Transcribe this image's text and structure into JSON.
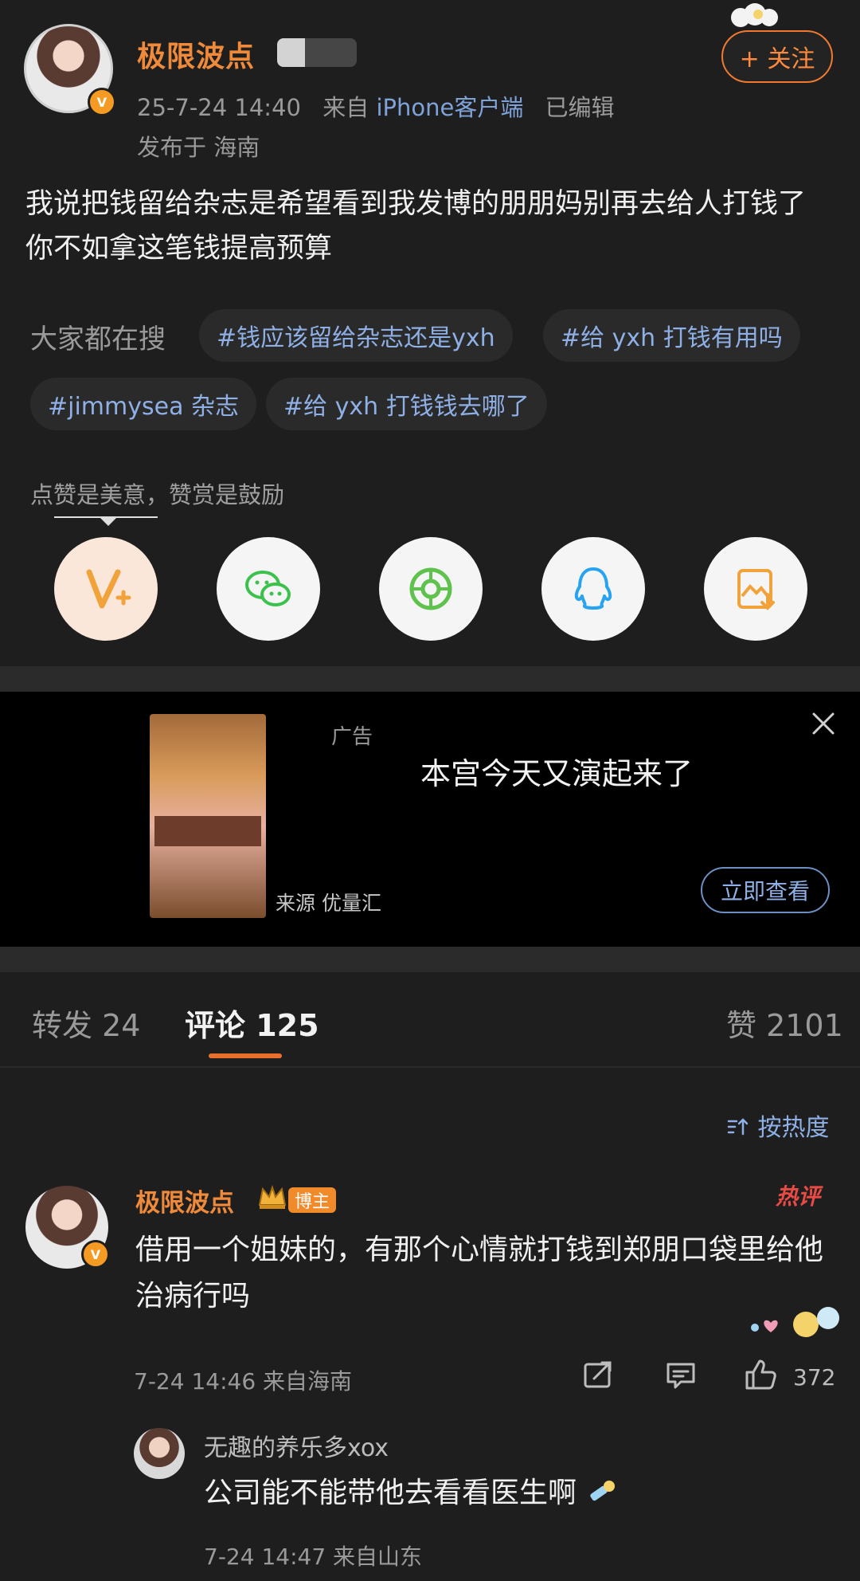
{
  "header": {
    "author": "极限波点",
    "time": "25-7-24 14:40",
    "source_prefix": "来自",
    "source_client": "iPhone客户端",
    "edited": "已编辑",
    "location": "发布于 海南",
    "follow_label": "+ 关注"
  },
  "post": {
    "text": "我说把钱留给杂志是希望看到我发博的朋朋妈别再去给人打钱了 你不如拿这笔钱提高预算"
  },
  "search": {
    "label": "大家都在搜",
    "tags": [
      "#钱应该留给杂志还是yxh",
      "#给 yxh 打钱有用吗",
      "#jimmysea 杂志",
      "#给 yxh 打钱钱去哪了"
    ]
  },
  "share": {
    "tip": "点赞是美意，赞赏是鼓励",
    "icons": [
      "reward-icon",
      "wechat-icon",
      "moments-icon",
      "qq-icon",
      "save-image-icon"
    ],
    "colors": {
      "reward": "#f2a23a",
      "wechat": "#3cc24c",
      "moments": "#5fc24c",
      "qq": "#27a3f0",
      "save": "#f2a23a"
    }
  },
  "ad": {
    "tag": "广告",
    "title": "本宫今天又演起来了",
    "source": "来源 优量汇",
    "cta": "立即查看"
  },
  "tabs": {
    "repost": "转发 24",
    "comments": "评论 125",
    "likes": "赞 2101"
  },
  "sort": {
    "label": "按热度"
  },
  "comment": {
    "author": "极限波点",
    "badge": "博主",
    "hot": "热评",
    "text": "借用一个姐妹的，有那个心情就打钱到郑朋口袋里给他治病行吗",
    "meta": "7-24 14:46  来自海南",
    "like_count": "372"
  },
  "reply": {
    "author": "无趣的养乐多xox",
    "text": "公司能不能带他去看看医生啊",
    "meta": "7-24 14:47  来自山东"
  },
  "colors": {
    "accent": "#ef7a2f",
    "link": "#8fb0e6",
    "bg": "#1e1e1e"
  }
}
